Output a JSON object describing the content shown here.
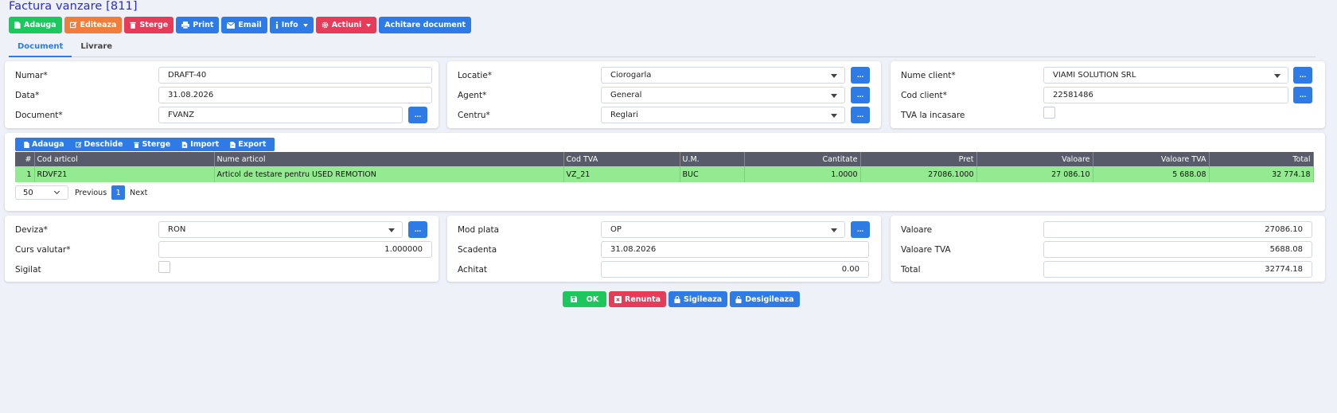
{
  "page_title": "Factura vanzare [811]",
  "colors": {
    "green": "#1cc85e",
    "orange": "#f07d3c",
    "red": "#e63c5a",
    "blue": "#2f7be6",
    "title": "#2a2ad4",
    "row_highlight": "#94ea90"
  },
  "toolbar": {
    "add": "Adauga",
    "edit": "Editeaza",
    "delete": "Sterge",
    "print": "Print",
    "email": "Email",
    "info": "Info",
    "actions": "Actiuni",
    "pay": "Achitare document"
  },
  "tabs": [
    {
      "label": "Document",
      "active": true
    },
    {
      "label": "Livrare",
      "active": false
    }
  ],
  "doc": {
    "numar_label": "Numar*",
    "numar_value": "DRAFT-40",
    "data_label": "Data*",
    "data_value": "31.08.2026",
    "document_label": "Document*",
    "document_value": "FVANZ"
  },
  "loc": {
    "locatie_label": "Locatie*",
    "locatie_value": "Ciorogarla",
    "agent_label": "Agent*",
    "agent_value": "General",
    "centru_label": "Centru*",
    "centru_value": "Reglari"
  },
  "client": {
    "nume_label": "Nume client*",
    "nume_value": "VIAMI SOLUTION SRL",
    "cod_label": "Cod client*",
    "cod_value": "22581486",
    "tva_label": "TVA la incasare",
    "tva_checked": false
  },
  "dots_label": "...",
  "grid_toolbar": {
    "add": "Adauga",
    "open": "Deschide",
    "delete": "Sterge",
    "import": "Import",
    "export": "Export"
  },
  "grid": {
    "columns": [
      "#",
      "Cod articol",
      "Nume articol",
      "Cod TVA",
      "U.M.",
      "Cantitate",
      "Pret",
      "Valoare",
      "Valoare TVA",
      "Total"
    ],
    "rows": [
      [
        "1",
        "RDVF21",
        "Articol de testare pentru USED REMOTION",
        "VZ_21",
        "BUC",
        "1.0000",
        "27086.1000",
        "27 086.10",
        "5 688.08",
        "32 774.18"
      ]
    ]
  },
  "pager": {
    "page_size": "50",
    "previous": "Previous",
    "page": "1",
    "next": "Next"
  },
  "currency": {
    "deviza_label": "Deviza*",
    "deviza_value": "RON",
    "curs_label": "Curs valutar*",
    "curs_value": "1.000000",
    "sigilat_label": "Sigilat",
    "sigilat_checked": false
  },
  "payment": {
    "mod_label": "Mod plata",
    "mod_value": "OP",
    "scadenta_label": "Scadenta",
    "scadenta_value": "31.08.2026",
    "achitat_label": "Achitat",
    "achitat_value": "0.00"
  },
  "totals": {
    "valoare_label": "Valoare",
    "valoare_value": "27086.10",
    "tva_label": "Valoare TVA",
    "tva_value": "5688.08",
    "total_label": "Total",
    "total_value": "32774.18"
  },
  "footer": {
    "ok": "OK",
    "cancel": "Renunta",
    "seal": "Sigileaza",
    "unseal": "Desigileaza"
  }
}
